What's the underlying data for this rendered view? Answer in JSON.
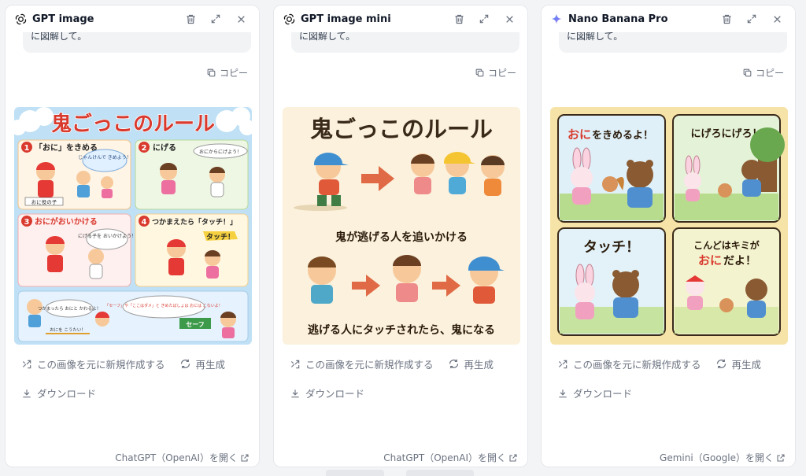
{
  "panels": [
    {
      "model_name": "GPT image",
      "model_icon": "openai-icon",
      "prompt_tail": "に図解して。",
      "copy_label": "コピー",
      "actions": {
        "remix_label": "この画像を元に新規作成する",
        "regenerate_label": "再生成",
        "download_label": "ダウンロード"
      },
      "open_link_label": "ChatGPT（OpenAI）を開く",
      "image": {
        "title": "鬼ごっこのルール",
        "steps": [
          {
            "num": "1",
            "text": "「おに」をきめる",
            "bubble": "じゃんけんで きめよう！",
            "caption": "おに役の子"
          },
          {
            "num": "2",
            "text": "にげる",
            "bubble": "おにからにげよう！"
          },
          {
            "num": "3",
            "text": "おにがおいかける",
            "bubble": "にげる子を おいかけよう！"
          },
          {
            "num": "4",
            "text": "つかまえたら「タッチ！」",
            "bubble": "タッチ！"
          }
        ],
        "bottom_left": "つかまったら おにと かわるよ！",
        "bottom_arrow": "おにを こうたい！",
        "bottom_right": "「セーフ」や「ここはダメ」と きめたばしょは おには こないよ！",
        "safe_sign": "セーフ"
      }
    },
    {
      "model_name": "GPT image mini",
      "model_icon": "openai-icon",
      "prompt_tail": "に図解して。",
      "copy_label": "コピー",
      "actions": {
        "remix_label": "この画像を元に新規作成する",
        "regenerate_label": "再生成",
        "download_label": "ダウンロード"
      },
      "open_link_label": "ChatGPT（OpenAI）を開く",
      "image": {
        "title": "鬼ごっこのルール",
        "caption1": "鬼が逃げる人を追いかける",
        "caption2": "逃げる人にタッチされたら、鬼になる"
      }
    },
    {
      "model_name": "Nano Banana Pro",
      "model_icon": "gemini-sparkle-icon",
      "prompt_tail": "に図解して。",
      "copy_label": "コピー",
      "actions": {
        "remix_label": "この画像を元に新規作成する",
        "regenerate_label": "再生成",
        "download_label": "ダウンロード"
      },
      "open_link_label": "Gemini（Google）を開く",
      "image": {
        "q1_a": "おに",
        "q1_b": "をきめるよ！",
        "q2": "にげろにげろ！",
        "q3": "タッチ！",
        "q4_line1": "こんどはキミが",
        "q4_a": "おに",
        "q4_b": "だよ！"
      }
    }
  ],
  "colors": {
    "accent_red": "#d93a2e",
    "sky": "#bfe0f5",
    "cream": "#fbf1dc",
    "gem_bg": "#f6e3a8"
  }
}
